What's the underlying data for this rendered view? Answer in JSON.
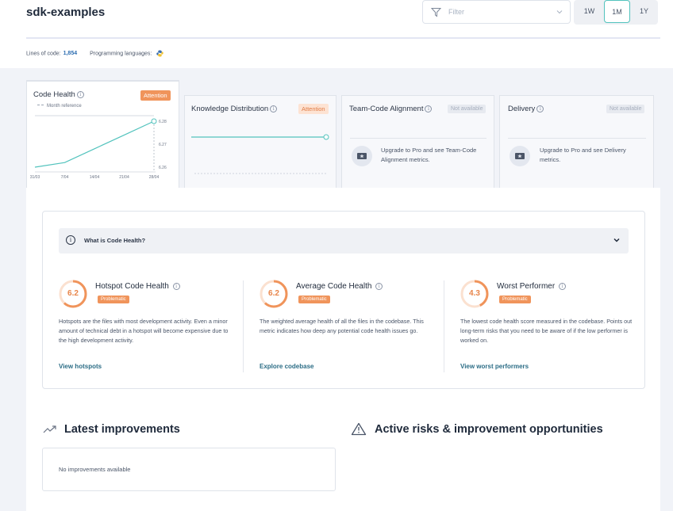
{
  "header": {
    "project_title": "sdk-examples",
    "filter_placeholder": "Filter",
    "periods": [
      "1W",
      "1M",
      "1Y"
    ],
    "active_period": "1M",
    "lines_of_code_label": "Lines of code:",
    "lines_of_code_value": "1,854",
    "languages_label": "Programming languages:",
    "language_icon": "python-icon"
  },
  "kpi_cards": {
    "code_health": {
      "title": "Code Health",
      "badge": "Attention",
      "legend": "Month reference",
      "chart_data": {
        "type": "line",
        "x": [
          "31/03",
          "7/04",
          "14/04",
          "21/04",
          "28/04"
        ],
        "ytick_labels": [
          "6.28",
          "6.27",
          "6.26"
        ],
        "series": [
          {
            "values": [
              6.26,
              6.262,
              6.268,
              6.274,
              6.28
            ]
          }
        ]
      }
    },
    "knowledge_distribution": {
      "title": "Knowledge Distribution",
      "badge": "Attention"
    },
    "team_code_alignment": {
      "title": "Team-Code Alignment",
      "badge": "Not available",
      "upgrade_line1": "Upgrade to Pro and see Team-Code",
      "upgrade_line2": "Alignment metrics."
    },
    "delivery": {
      "title": "Delivery",
      "badge": "Not available",
      "upgrade_line1": "Upgrade to Pro and see Delivery",
      "upgrade_line2": "metrics."
    }
  },
  "code_health_panel": {
    "what_is_label": "What is Code Health?",
    "metrics": [
      {
        "value": "6.2",
        "title": "Hotspot Code Health",
        "badge": "Problematic",
        "desc": "Hotspots are the files with most development activity. Even a minor amount of technical debt in a hotspot will become expensive due to the high development activity.",
        "link": "View hotspots"
      },
      {
        "value": "6.2",
        "title": "Average Code Health",
        "badge": "Problematic",
        "desc": "The weighted average health of all the files in the codebase. This metric indicates how deep any potential code health issues go.",
        "link": "Explore codebase"
      },
      {
        "value": "4.3",
        "title": "Worst Performer",
        "badge": "Problematic",
        "desc": "The lowest code health score measured in the codebase. Points out long-term risks that you need to be aware of if the low performer is worked on.",
        "link": "View worst performers"
      }
    ]
  },
  "sections": {
    "latest_improvements_title": "Latest improvements",
    "no_improvements": "No improvements available",
    "active_risks_title": "Active risks & improvement opportunities"
  },
  "colors": {
    "accent_teal": "#52c3bd",
    "attention_orange": "#f0945b",
    "link_blue": "#2c6d86"
  }
}
